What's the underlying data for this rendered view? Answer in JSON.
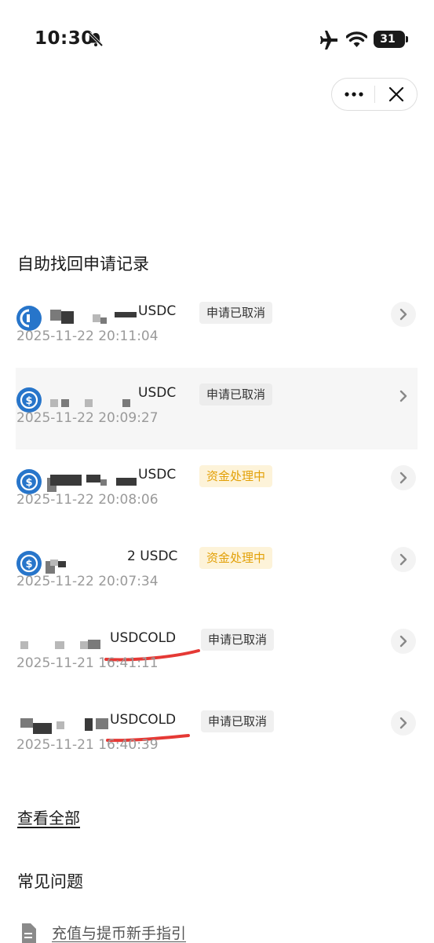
{
  "status_bar": {
    "time": "10:30",
    "battery": "31"
  },
  "section_title": "自助找回申请记录",
  "records": [
    {
      "amount_suffix": "USDC",
      "status": "申请已取消",
      "status_type": "cancel",
      "time": "2025-11-22 20:11:04"
    },
    {
      "amount_suffix": "USDC",
      "status": "申请已取消",
      "status_type": "cancel",
      "time": "2025-11-22 20:09:27"
    },
    {
      "amount_suffix": "USDC",
      "status": "资金处理中",
      "status_type": "processing",
      "time": "2025-11-22 20:08:06"
    },
    {
      "amount_suffix": "2 USDC",
      "status": "资金处理中",
      "status_type": "processing",
      "time": "2025-11-22 20:07:34"
    },
    {
      "amount_suffix": "USDCOLD",
      "status": "申请已取消",
      "status_type": "cancel",
      "time": "2025-11-21 16:41:11"
    },
    {
      "amount_suffix": "USDCOLD",
      "status": "申请已取消",
      "status_type": "cancel",
      "time": "2025-11-21 16:40:39"
    }
  ],
  "view_all": "查看全部",
  "faq_title": "常见问题",
  "faq_links": [
    "充值与提币新手指引"
  ],
  "colors": {
    "coin_blue": "#2775ca",
    "processing_text": "#e2a007",
    "processing_bg": "#fdf3d9",
    "cancel_bg": "#f0f0f0",
    "annotation_red": "#e53935"
  }
}
